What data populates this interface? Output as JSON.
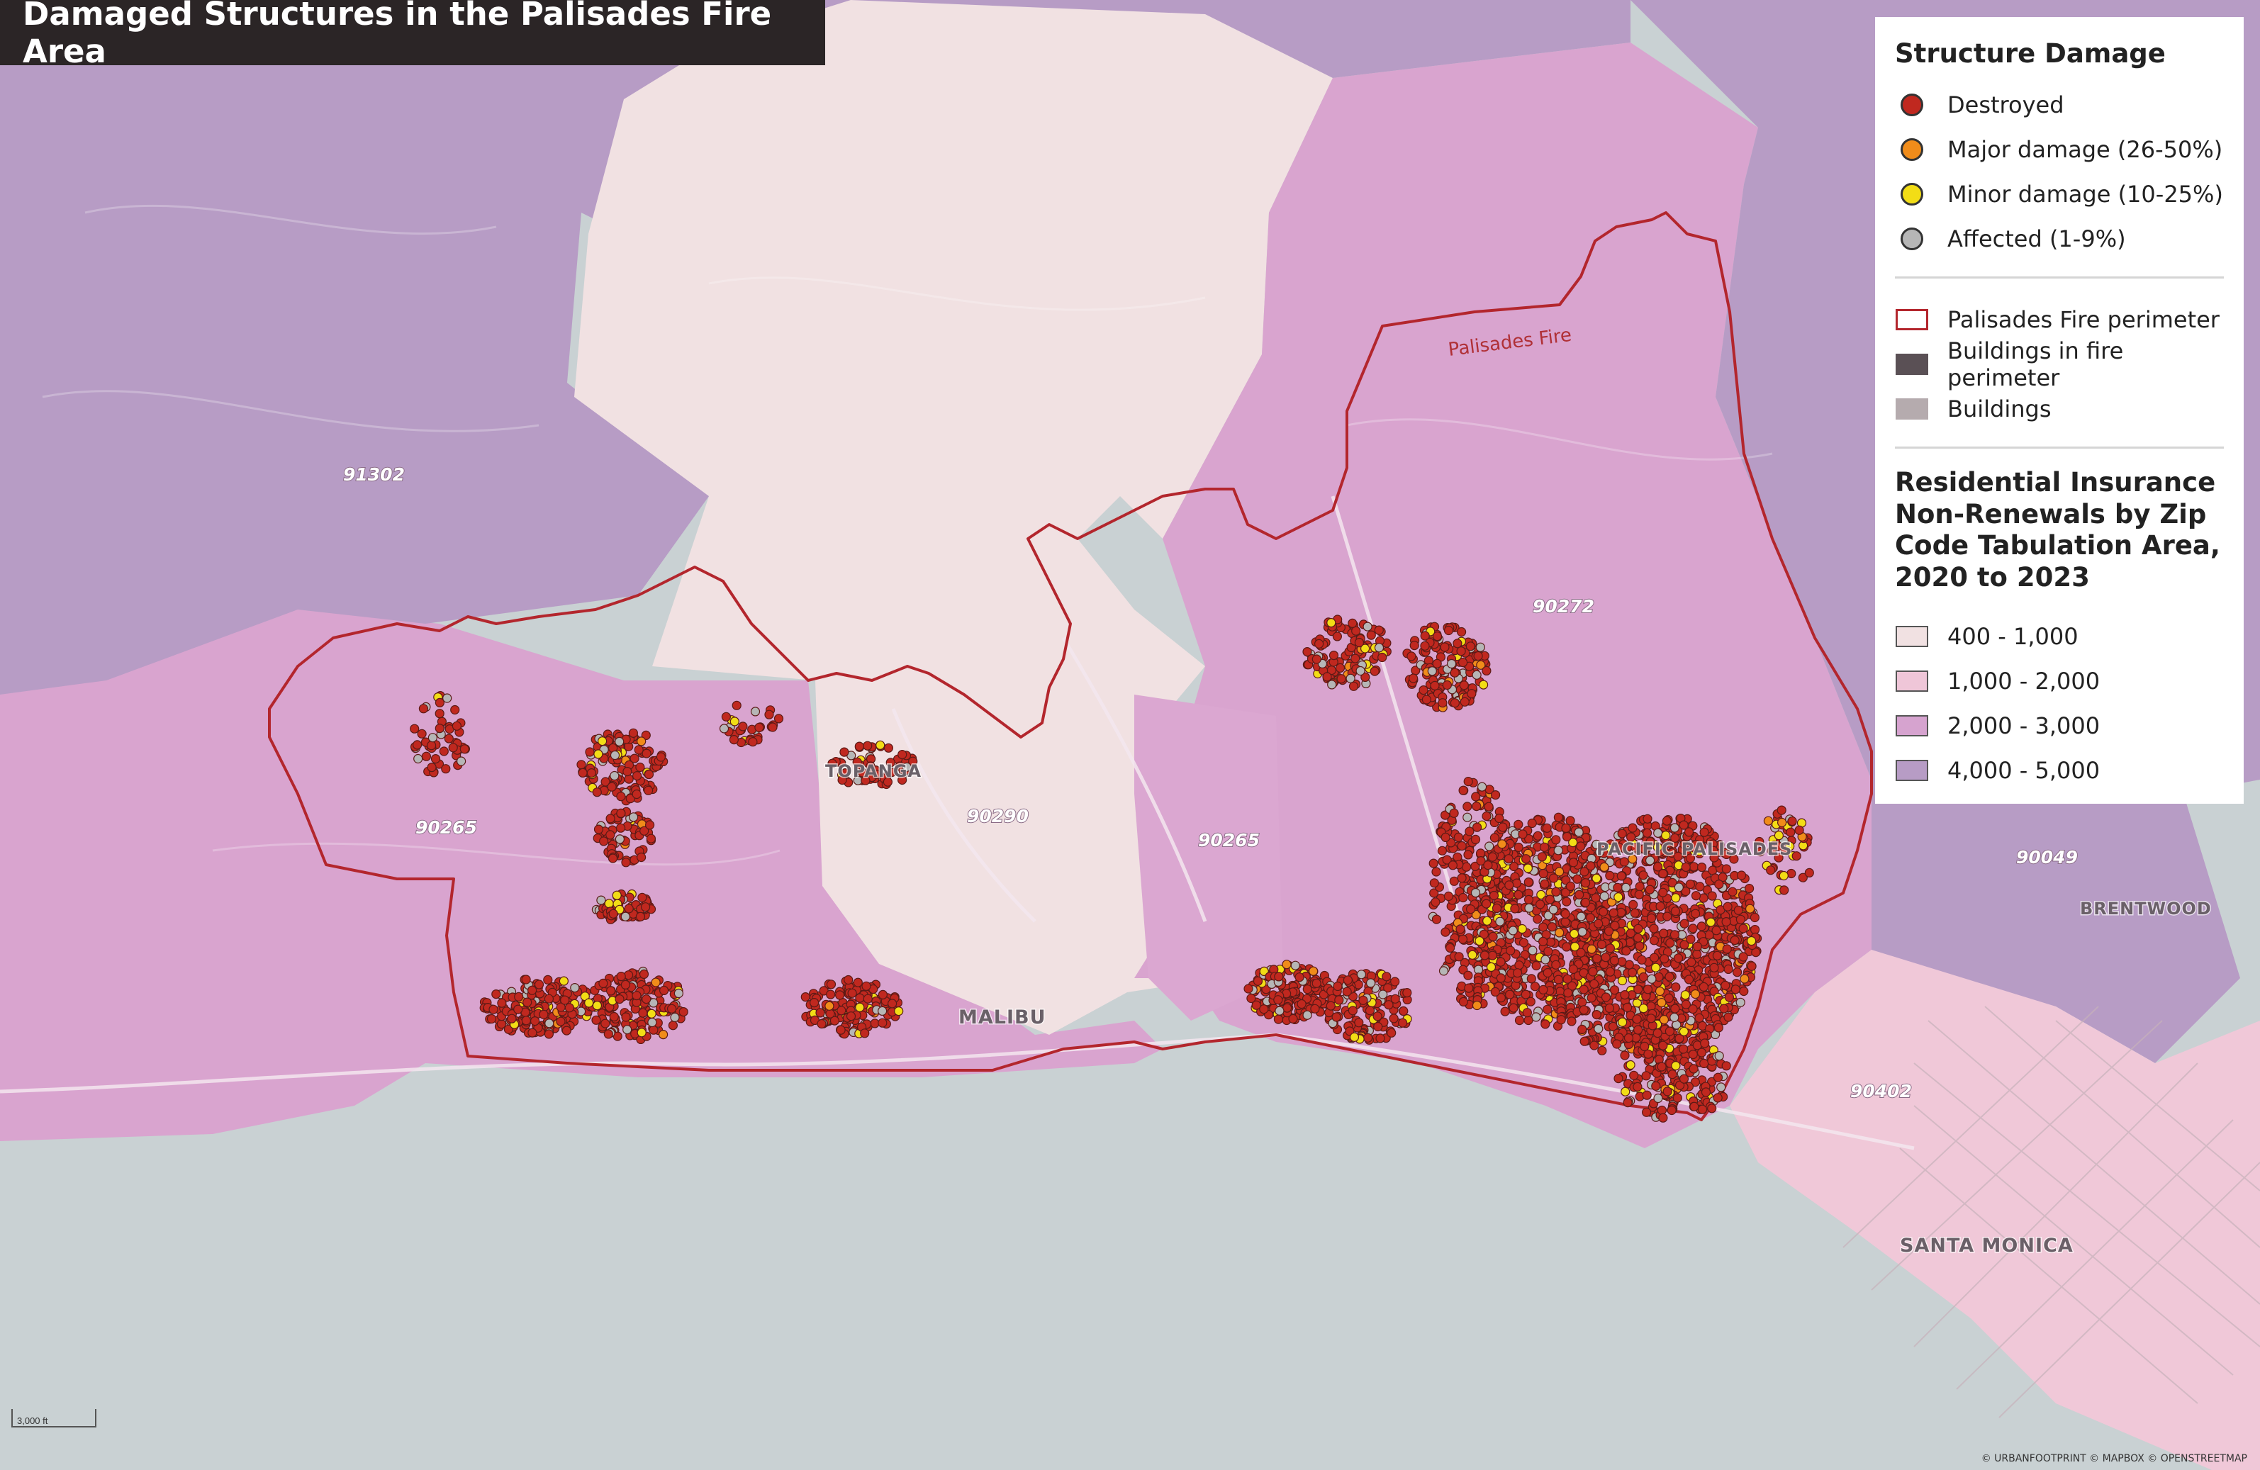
{
  "map": {
    "title": "Damaged Structures in the Palisades Fire Area",
    "fire_label": "Palisades Fire",
    "zip_labels": [
      "91302",
      "90272",
      "90265",
      "90290",
      "90265",
      "90049",
      "90402"
    ],
    "place_labels": [
      "TOPANGA",
      "MALIBU",
      "PACIFIC PALISADES",
      "BRENTWOOD",
      "SANTA MONICA"
    ],
    "scale_label": "3,000 ft",
    "credit": "© URBANFOOTPRINT © MAPBOX © OPENSTREETMAP",
    "colors": {
      "ocean": "#c9d1d3",
      "class_400_1000": "#f1e1e2",
      "class_1000_2000": "#efc6d8",
      "class_2000_3000": "#d6a3cf",
      "class_4000_5000": "#b79cc5",
      "fire_perimeter": "#b3262d",
      "destroyed": "#c0281f",
      "major": "#f08c1a",
      "minor": "#f2dd16",
      "affected": "#b6b6b6"
    }
  },
  "legend": {
    "damage_title": "Structure Damage",
    "damage_items": [
      {
        "label": "Destroyed",
        "color": "#c0281f"
      },
      {
        "label": "Major damage (26-50%)",
        "color": "#f08c1a"
      },
      {
        "label": "Minor damage (10-25%)",
        "color": "#f2dd16"
      },
      {
        "label": "Affected (1-9%)",
        "color": "#b6b6b6"
      }
    ],
    "layer_items": [
      {
        "label": "Palisades Fire perimeter",
        "icon": "fire-perimeter-outline"
      },
      {
        "label": "Buildings in fire perimeter",
        "icon": "dark-building-fill",
        "color": "#5a5055"
      },
      {
        "label": "Buildings",
        "icon": "light-building-fill",
        "color": "#b5abae"
      }
    ],
    "choropleth_title": "Residential Insurance Non-Renewals by Zip Code Tabulation Area, 2020 to 2023",
    "choropleth_items": [
      {
        "label": "400 - 1,000",
        "color": "#f1e1e2"
      },
      {
        "label": "1,000 - 2,000",
        "color": "#efc6d8"
      },
      {
        "label": "2,000 - 3,000",
        "color": "#d6a3cf"
      },
      {
        "label": "4,000 - 5,000",
        "color": "#b79cc5"
      }
    ]
  }
}
